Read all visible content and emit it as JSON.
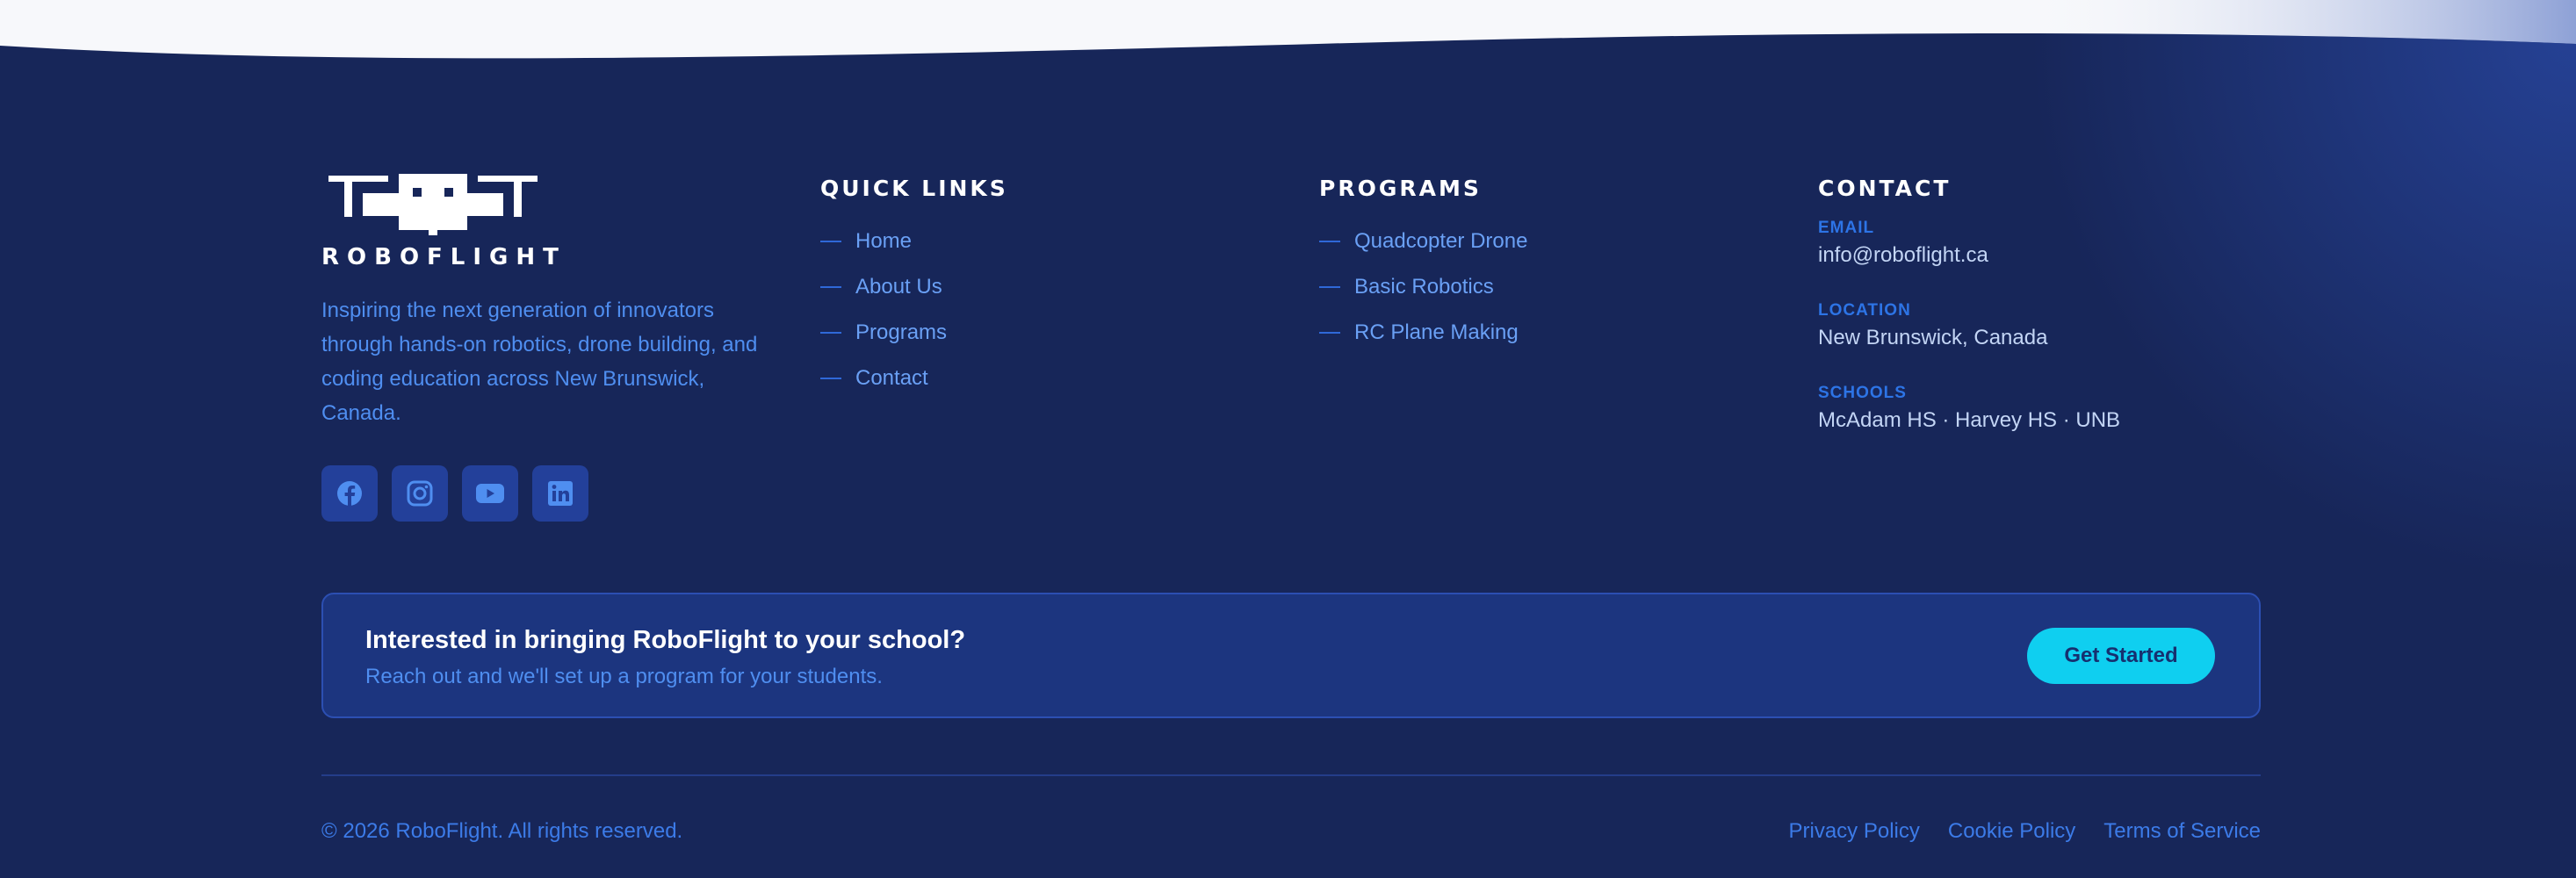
{
  "colors": {
    "background": "#172659",
    "accent": "#0fcff0",
    "link": "#6aa0f5",
    "label": "#2d74e6"
  },
  "brand": {
    "name": "ROBOFLIGHT",
    "logo_icon": "drone-icon",
    "description": "Inspiring the next generation of innovators through hands-on robotics, drone building, and coding education across New Brunswick, Canada.",
    "socials": [
      {
        "icon": "facebook-icon"
      },
      {
        "icon": "instagram-icon"
      },
      {
        "icon": "youtube-icon"
      },
      {
        "icon": "linkedin-icon"
      }
    ]
  },
  "quick_links": {
    "title": "QUICK LINKS",
    "items": [
      {
        "label": "Home"
      },
      {
        "label": "About Us"
      },
      {
        "label": "Programs"
      },
      {
        "label": "Contact"
      }
    ]
  },
  "programs": {
    "title": "PROGRAMS",
    "items": [
      {
        "label": "Quadcopter Drone"
      },
      {
        "label": "Basic Robotics"
      },
      {
        "label": "RC Plane Making"
      }
    ]
  },
  "contact": {
    "title": "CONTACT",
    "email_label": "EMAIL",
    "email": "info@roboflight.ca",
    "location_label": "LOCATION",
    "location": "New Brunswick, Canada",
    "schools_label": "SCHOOLS",
    "schools": "McAdam HS · Harvey HS · UNB"
  },
  "cta": {
    "title": "Interested in bringing RoboFlight to your school?",
    "subtitle": "Reach out and we'll set up a program for your students.",
    "button_label": "Get Started"
  },
  "bottom": {
    "copyright": "© 2026 RoboFlight. All rights reserved.",
    "legal": [
      {
        "label": "Privacy Policy"
      },
      {
        "label": "Cookie Policy"
      },
      {
        "label": "Terms of Service"
      }
    ]
  }
}
